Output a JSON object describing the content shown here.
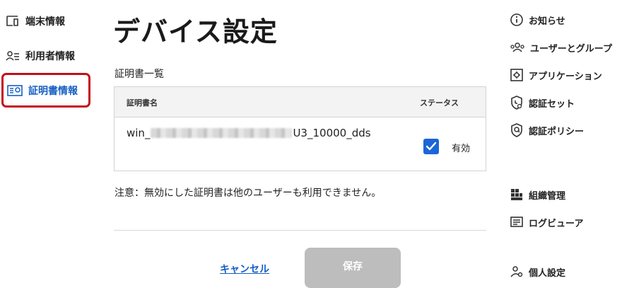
{
  "left_nav": {
    "items": [
      {
        "label": "端末情報",
        "icon": "device-icon"
      },
      {
        "label": "利用者情報",
        "icon": "user-list-icon"
      },
      {
        "label": "証明書情報",
        "icon": "certificate-icon",
        "active": true
      }
    ]
  },
  "main": {
    "title": "デバイス設定",
    "section_label": "証明書一覧",
    "table": {
      "headers": {
        "name": "証明書名",
        "status": "ステータス"
      },
      "rows": [
        {
          "name_prefix": "win_",
          "name_suffix": "U3_10000_dds",
          "enabled": true,
          "status_label": "有効"
        }
      ]
    },
    "note": "注意：無効にした証明書は他のユーザーも利用できません。",
    "cancel_label": "キャンセル",
    "save_label": "保存"
  },
  "right_nav": {
    "items": [
      {
        "label": "お知らせ",
        "icon": "info-icon"
      },
      {
        "label": "ユーザーとグループ",
        "icon": "users-group-icon"
      },
      {
        "label": "アプリケーション",
        "icon": "application-icon"
      },
      {
        "label": "認証セット",
        "icon": "auth-set-icon"
      },
      {
        "label": "認証ポリシー",
        "icon": "auth-policy-icon"
      },
      {
        "label": "組織管理",
        "icon": "organization-icon"
      },
      {
        "label": "ログビューア",
        "icon": "log-viewer-icon"
      },
      {
        "label": "個人設定",
        "icon": "personal-settings-icon"
      }
    ]
  },
  "colors": {
    "accent": "#1660c4",
    "highlight_border": "#c40f1a",
    "checkbox": "#1a66d6",
    "disabled_button": "#bdbdbd"
  }
}
